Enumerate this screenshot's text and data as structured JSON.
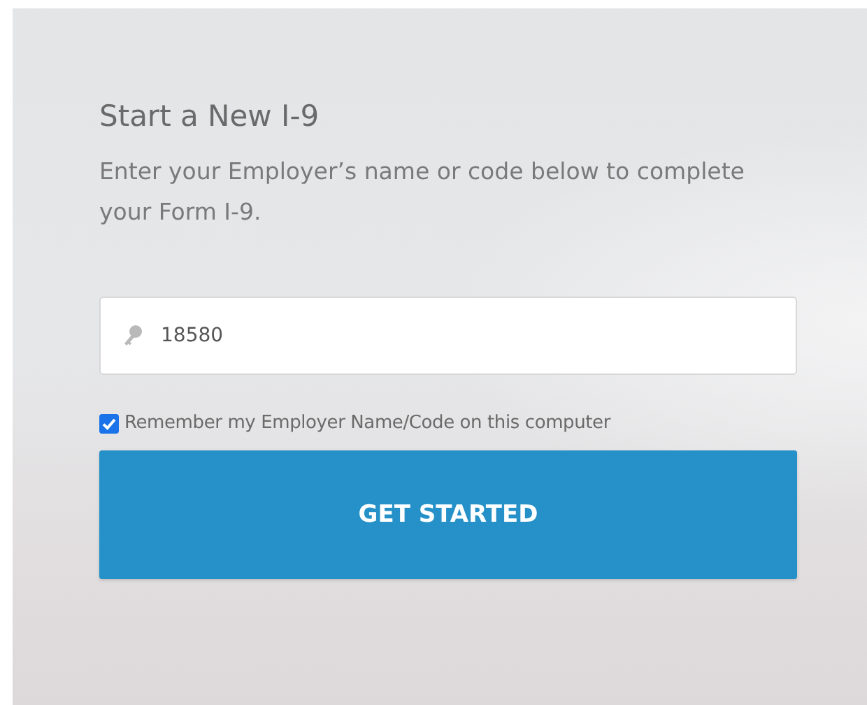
{
  "title": "Start a New I-9",
  "description": "Enter your Employer’s name or code below to complete your Form I-9.",
  "employer_field": {
    "value": "18580"
  },
  "remember": {
    "label": "Remember my Employer Name/Code on this computer",
    "checked": true
  },
  "submit_button": {
    "label": "GET STARTED"
  }
}
